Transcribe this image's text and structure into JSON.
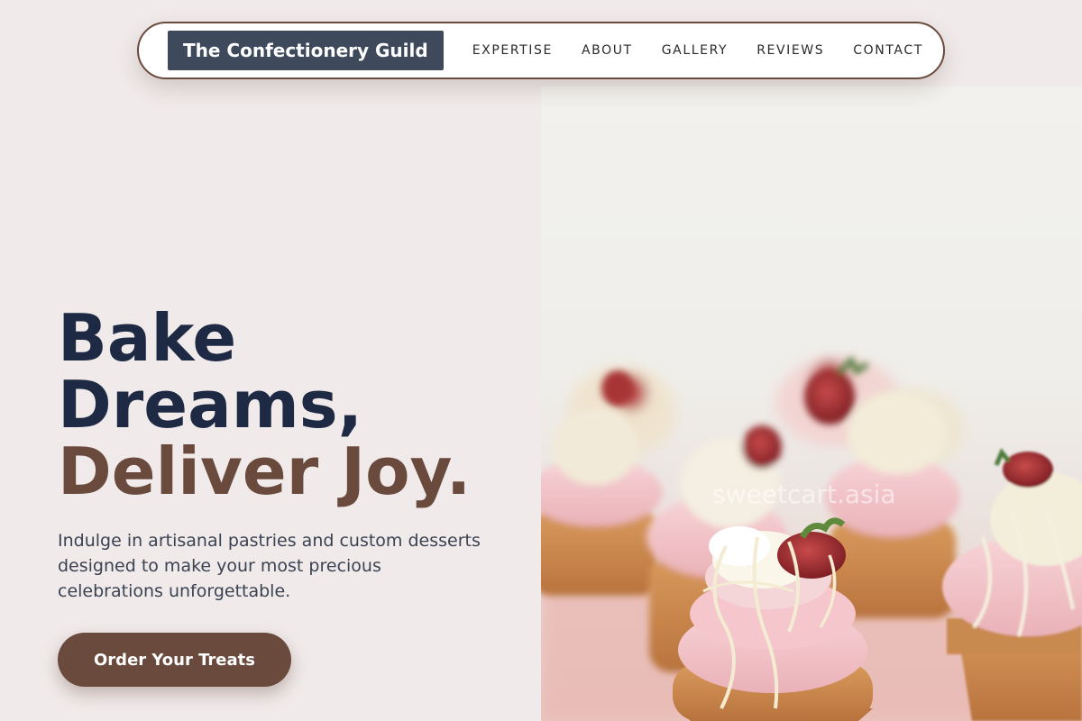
{
  "nav": {
    "brand": "The Confectionery Guild",
    "links": [
      "EXPERTISE",
      "ABOUT",
      "GALLERY",
      "REVIEWS",
      "CONTACT"
    ]
  },
  "hero": {
    "headline_line1": "Bake",
    "headline_line2": "Dreams,",
    "headline_accent": "Deliver Joy.",
    "subtitle": "Indulge in artisanal pastries and custom desserts designed to make your most precious celebrations unforgettable.",
    "cta_label": "Order Your Treats"
  },
  "image": {
    "watermark": "sweetcart.asia",
    "subject": "strawberry-topped cupcakes with pink frosting"
  },
  "colors": {
    "background": "#f0eaea",
    "brand_bg": "#3e4a5c",
    "headline": "#1e2a44",
    "accent_brown": "#6b4a3e",
    "body_text": "#3b4252"
  }
}
